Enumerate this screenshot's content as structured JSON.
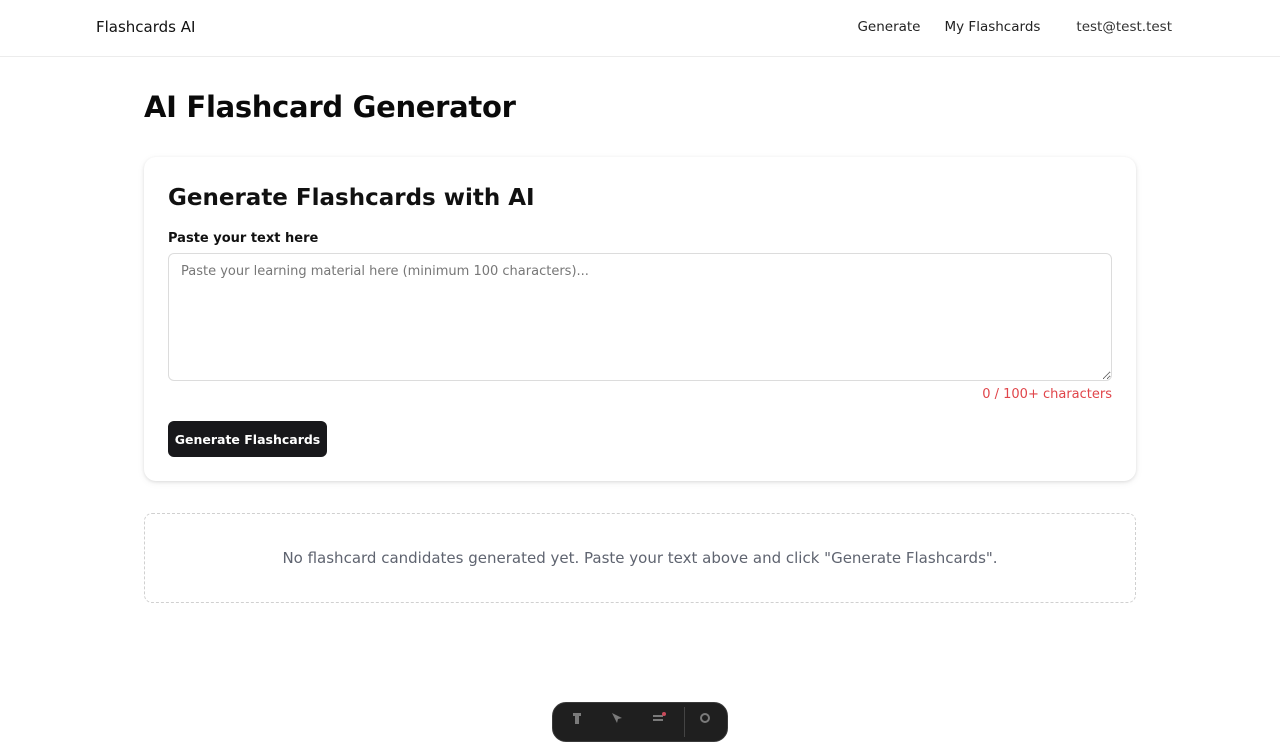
{
  "header": {
    "brand": "Flashcards AI",
    "nav": [
      {
        "label": "Generate"
      },
      {
        "label": "My Flashcards"
      }
    ],
    "user_email": "test@test.test"
  },
  "page": {
    "title": "AI Flashcard Generator"
  },
  "generator": {
    "title": "Generate Flashcards with AI",
    "field_label": "Paste your text here",
    "textarea_value": "",
    "textarea_placeholder": "Paste your learning material here (minimum 100 characters)...",
    "char_count": "0 / 100+ characters",
    "char_count_color": "#e0454a",
    "button_label": "Generate Flashcards",
    "button_color": "#18181b"
  },
  "candidates": {
    "empty_message": "No flashcard candidates generated yet. Paste your text above and click \"Generate Flashcards\"."
  },
  "devtools_dock": {
    "icons": [
      "toolbar-tool-icon",
      "toolbar-inspect-icon",
      "toolbar-audit-icon",
      "toolbar-settings-icon"
    ]
  }
}
